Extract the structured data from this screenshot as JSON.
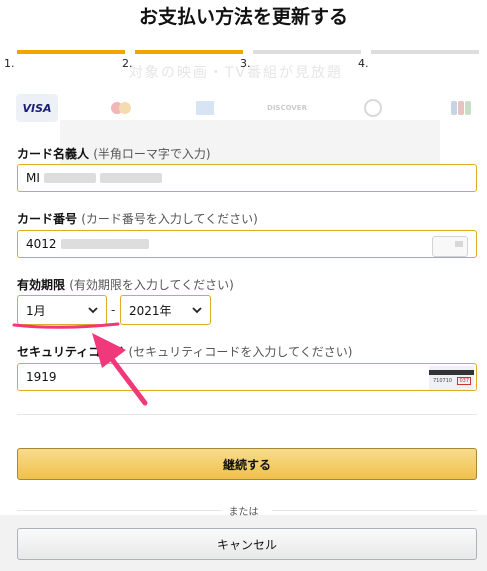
{
  "page": {
    "title": "お支払い方法を更新する"
  },
  "steps": [
    {
      "num": "1.",
      "color": "#f0a400"
    },
    {
      "num": "2.",
      "color": "#f0a400"
    },
    {
      "num": "3.",
      "color": "#dddddd"
    },
    {
      "num": "4.",
      "color": "#dddddd"
    }
  ],
  "background_text": "対象の映画・TV番組が見放題",
  "cards": [
    {
      "label": "VISA",
      "icon": "visa-icon"
    },
    {
      "label": "mastercard",
      "icon": "mastercard-icon"
    },
    {
      "label": "AMEX",
      "icon": "amex-icon"
    },
    {
      "label": "DISCOVER",
      "icon": "discover-icon"
    },
    {
      "label": "Diners",
      "icon": "diners-icon"
    },
    {
      "label": "JCB",
      "icon": "jcb-icon"
    }
  ],
  "form": {
    "name": {
      "label": "カード名義人",
      "hint": "(半角ローマ字で入力)",
      "value": "MI"
    },
    "number": {
      "label": "カード番号",
      "hint": "(カード番号を入力してください)",
      "value": "4012"
    },
    "expiry": {
      "label": "有効期限",
      "hint": "(有効期限を入力してください)",
      "month": "1月",
      "year": "2021年",
      "sep": "-"
    },
    "cvv": {
      "label": "セキュリティコード",
      "hint": "(セキュリティコードを入力してください)",
      "value": "1919",
      "card_num": "710710",
      "card_code": "037"
    }
  },
  "buttons": {
    "continue": "継続する",
    "or": "または",
    "cancel": "キャンセル"
  },
  "colors": {
    "accent": "#f0a400",
    "annotation": "#f0397a"
  }
}
